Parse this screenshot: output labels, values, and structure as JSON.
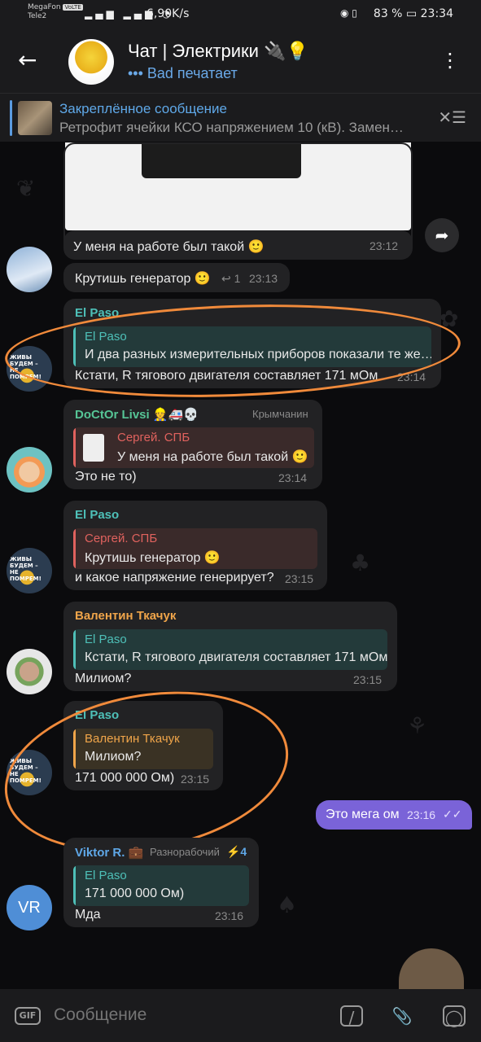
{
  "status_bar": {
    "carrier_1": "MegaFon",
    "carrier_badge": "VoLTE",
    "carrier_2": "Tele2",
    "net_speed": "6,90K/s",
    "battery": "83 %",
    "time": "23:34"
  },
  "header": {
    "back_icon": "back-arrow-icon",
    "title": "Чат | Электрики 🔌💡",
    "typing": "••• Bad печатает",
    "menu_icon": "more-vertical-icon"
  },
  "pinned": {
    "title": "Закреплённое сообщение",
    "text": "Ретрофит ячейки КСО напряжением 10 (кВ). Замен…"
  },
  "messages": {
    "m1": {
      "text": "У меня на работе был такой 🙂",
      "time": "23:12"
    },
    "m2": {
      "text": "Крутишь генератор 🙂",
      "reply_count": "↩ 1",
      "time": "23:13"
    },
    "m3": {
      "sender": "El Paso",
      "quote_name": "El Paso",
      "quote_text": "И два разных измерительных приборов показали те же…",
      "text": "Кстати, R тягового двигателя составляет  171 мОм",
      "time": "23:14"
    },
    "m4": {
      "sender": "DoCtOr Livsi 👷🚑💀",
      "badge": "Крымчанин",
      "quote_name": "Сергей. СПБ",
      "quote_text": "У меня на работе был такой 🙂",
      "text": "Это не то)",
      "time": "23:14"
    },
    "m5": {
      "sender": "El Paso",
      "quote_name": "Сергей. СПБ",
      "quote_text": "Крутишь генератор 🙂",
      "text": "и какое напряжение генерирует?",
      "time": "23:15"
    },
    "m6": {
      "sender": "Валентин Ткачук",
      "quote_name": "El Paso",
      "quote_text": "Кстати, R тягового двигателя составляет  171 мОм",
      "text": "Милиом?",
      "time": "23:15"
    },
    "m7": {
      "sender": "El Paso",
      "quote_name": "Валентин Ткачук",
      "quote_text": "Милиом?",
      "text": "171 000 000 Ом)",
      "time": "23:15"
    },
    "m8": {
      "text": "Это мега ом",
      "time": "23:16",
      "ticks": "✓✓"
    },
    "m9": {
      "sender": "Viktor R. 💼",
      "badge": "Разнорабочий",
      "boost": "⚡4",
      "quote_name": "El Paso",
      "quote_text": "171 000 000 Ом)",
      "text": "Мда",
      "time": "23:16"
    }
  },
  "avatars": {
    "el_paso_caption": "ЖИВЫ БУДЕМ – НЕ ПОМРЕМ!",
    "vr_initials": "VR"
  },
  "input": {
    "gif_label": "GIF",
    "placeholder": "Сообщение"
  },
  "colors": {
    "accent_blue": "#5fa8e8",
    "name_green": "#56c596",
    "name_orange": "#f0a54a",
    "name_teal": "#4ec0b8",
    "outgoing": "#7a63d8",
    "annotation": "#f08a3b"
  }
}
